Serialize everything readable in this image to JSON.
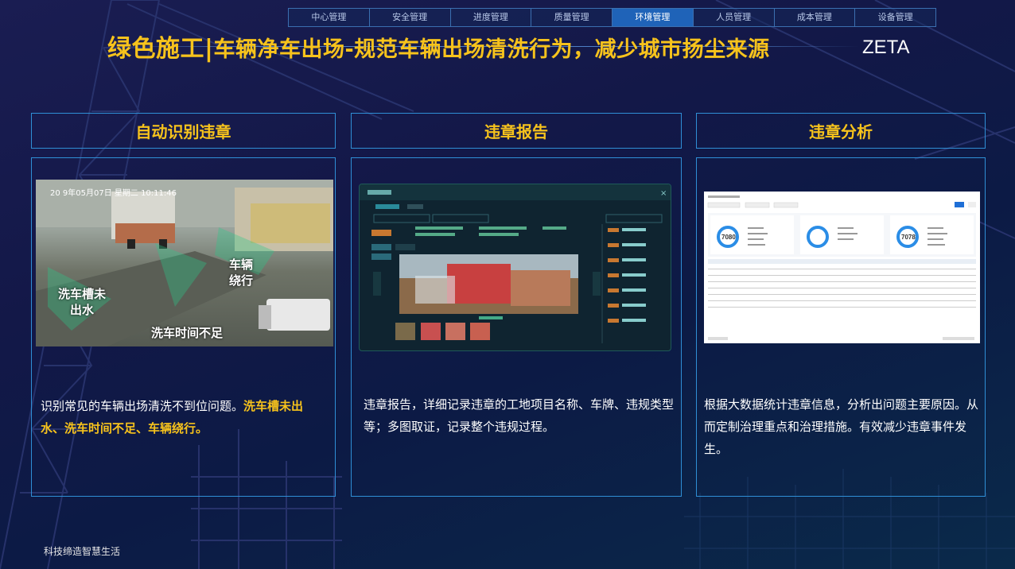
{
  "nav": {
    "tabs": [
      "中心管理",
      "安全管理",
      "进度管理",
      "质量管理",
      "环境管理",
      "人员管理",
      "成本管理",
      "设备管理"
    ],
    "active": "环境管理"
  },
  "header": {
    "title_main": "绿色施工|",
    "title_rest": "车辆净车出场-规范车辆出场清洗行为，减少城市扬尘来源",
    "brand": "ZETA"
  },
  "panels": [
    {
      "title": "自动识别违章",
      "image_labels": {
        "washer_water": "洗车槽未\n出水",
        "vehicle_bypass": "车辆\n绕行",
        "wash_time": "洗车时间不足",
        "timestamp": "20 9年05月07日 星期二 10:11:46"
      },
      "desc_plain": "识别常见的车辆出场清洗不到位问题。",
      "desc_highlight": "洗车槽未出水、洗车时间不足、车辆绕行。"
    },
    {
      "title": "违章报告",
      "desc_plain": "违章报告，详细记录违章的工地项目名称、车牌、违规类型等；多图取证，记录整个违规过程。"
    },
    {
      "title": "违章分析",
      "stats": [
        "7080",
        "7078"
      ],
      "desc_plain": "根据大数据统计违章信息，分析出问题主要原因。从而定制治理重点和治理措施。有效减少违章事件发生。"
    }
  ],
  "footer": {
    "slogan": "科技缔造智慧生活"
  },
  "colors": {
    "accent": "#f7c31c",
    "border": "#2f8fd6",
    "active_tab": "#1f63b8"
  }
}
